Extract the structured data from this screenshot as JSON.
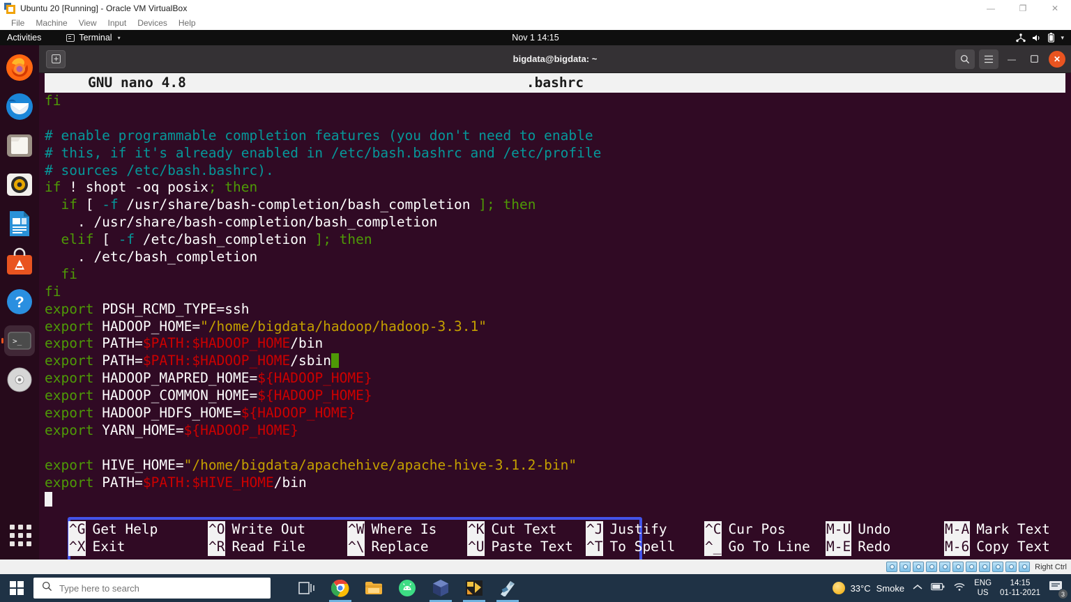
{
  "vbox": {
    "title": "Ubuntu 20 [Running] - Oracle VM VirtualBox",
    "menus": [
      "File",
      "Machine",
      "View",
      "Input",
      "Devices",
      "Help"
    ],
    "window_controls": {
      "minimize": "—",
      "maximize": "❐",
      "close": "✕"
    },
    "status_hint": "Right Ctrl"
  },
  "gnome": {
    "activities": "Activities",
    "app_name": "Terminal",
    "app_caret": "▾",
    "clock": "Nov 1  14:15",
    "tray_icons": [
      "network-icon",
      "volume-icon",
      "battery-icon",
      "chevron-down-icon"
    ]
  },
  "dock": {
    "items": [
      {
        "name": "firefox",
        "label": "Firefox"
      },
      {
        "name": "thunderbird",
        "label": "Thunderbird Mail"
      },
      {
        "name": "files",
        "label": "Files"
      },
      {
        "name": "rhythmbox",
        "label": "Rhythmbox"
      },
      {
        "name": "libreoffice-writer",
        "label": "LibreOffice Writer"
      },
      {
        "name": "ubuntu-software",
        "label": "Ubuntu Software"
      },
      {
        "name": "help",
        "label": "Help"
      },
      {
        "name": "terminal",
        "label": "Terminal"
      },
      {
        "name": "disk",
        "label": "Disk Image"
      }
    ],
    "show_apps": "Show Applications"
  },
  "terminal": {
    "title": "bigdata@bigdata: ~",
    "new_tab_label": "+",
    "search_label": "⌕",
    "menu_label": "☰",
    "minimize_label": "—",
    "maximize_label": "❐",
    "close_label": "✕"
  },
  "nano": {
    "version": "GNU nano 4.8",
    "filename": ".bashrc",
    "lines": [
      [
        {
          "t": "fi",
          "c": "c-green"
        }
      ],
      [],
      [
        {
          "t": "# enable programmable completion features (you don't need to enable",
          "c": "c-cyan"
        }
      ],
      [
        {
          "t": "# this, if it's already enabled in /etc/bash.bashrc and /etc/profile",
          "c": "c-cyan"
        }
      ],
      [
        {
          "t": "# sources /etc/bash.bashrc).",
          "c": "c-cyan"
        }
      ],
      [
        {
          "t": "if",
          "c": "c-green"
        },
        {
          "t": " ! shopt -oq posix",
          "c": "c-white"
        },
        {
          "t": "; then",
          "c": "c-green"
        }
      ],
      [
        {
          "t": "  if",
          "c": "c-green"
        },
        {
          "t": " [ ",
          "c": "c-white"
        },
        {
          "t": "-f",
          "c": "c-cyan"
        },
        {
          "t": " /usr/share/bash-completion/bash_completion ",
          "c": "c-white"
        },
        {
          "t": "]; then",
          "c": "c-green"
        }
      ],
      [
        {
          "t": "    . /usr/share/bash-completion/bash_completion",
          "c": "c-white"
        }
      ],
      [
        {
          "t": "  elif",
          "c": "c-green"
        },
        {
          "t": " [ ",
          "c": "c-white"
        },
        {
          "t": "-f",
          "c": "c-cyan"
        },
        {
          "t": " /etc/bash_completion ",
          "c": "c-white"
        },
        {
          "t": "]; then",
          "c": "c-green"
        }
      ],
      [
        {
          "t": "    . /etc/bash_completion",
          "c": "c-white"
        }
      ],
      [
        {
          "t": "  fi",
          "c": "c-green"
        }
      ],
      [
        {
          "t": "fi",
          "c": "c-green"
        }
      ],
      [
        {
          "t": "export",
          "c": "c-green"
        },
        {
          "t": " PDSH_RCMD_TYPE=ssh",
          "c": "c-white"
        }
      ],
      [
        {
          "t": "export",
          "c": "c-green"
        },
        {
          "t": " HADOOP_HOME=",
          "c": "c-white"
        },
        {
          "t": "\"/home/bigdata/hadoop/hadoop-3.3.1\"",
          "c": "c-yellow"
        }
      ],
      [
        {
          "t": "export",
          "c": "c-green"
        },
        {
          "t": " PATH=",
          "c": "c-white"
        },
        {
          "t": "$PATH:$HADOOP_HOME",
          "c": "c-red"
        },
        {
          "t": "/bin",
          "c": "c-white"
        }
      ],
      [
        {
          "t": "export",
          "c": "c-green"
        },
        {
          "t": " PATH=",
          "c": "c-white"
        },
        {
          "t": "$PATH:$HADOOP_HOME",
          "c": "c-red"
        },
        {
          "t": "/sbin",
          "c": "c-white"
        },
        {
          "t": "",
          "c": "cursor-green"
        }
      ],
      [
        {
          "t": "export",
          "c": "c-green"
        },
        {
          "t": " HADOOP_MAPRED_HOME=",
          "c": "c-white"
        },
        {
          "t": "${HADOOP_HOME}",
          "c": "c-red"
        }
      ],
      [
        {
          "t": "export",
          "c": "c-green"
        },
        {
          "t": " HADOOP_COMMON_HOME=",
          "c": "c-white"
        },
        {
          "t": "${HADOOP_HOME}",
          "c": "c-red"
        }
      ],
      [
        {
          "t": "export",
          "c": "c-green"
        },
        {
          "t": " HADOOP_HDFS_HOME=",
          "c": "c-white"
        },
        {
          "t": "${HADOOP_HOME}",
          "c": "c-red"
        }
      ],
      [
        {
          "t": "export",
          "c": "c-green"
        },
        {
          "t": " YARN_HOME=",
          "c": "c-white"
        },
        {
          "t": "${HADOOP_HOME}",
          "c": "c-red"
        }
      ],
      [],
      [
        {
          "t": "export",
          "c": "c-green"
        },
        {
          "t": " HIVE_HOME=",
          "c": "c-white"
        },
        {
          "t": "\"/home/bigdata/apachehive/apache-hive-3.1.2-bin\"",
          "c": "c-yellow"
        }
      ],
      [
        {
          "t": "export",
          "c": "c-green"
        },
        {
          "t": " PATH=",
          "c": "c-white"
        },
        {
          "t": "$PATH:$HIVE_HOME",
          "c": "c-red"
        },
        {
          "t": "/bin",
          "c": "c-white"
        }
      ],
      [
        {
          "t": "",
          "c": "cursor-white"
        }
      ]
    ],
    "shortcuts_row1": [
      {
        "key": "^G",
        "label": "Get Help"
      },
      {
        "key": "^O",
        "label": "Write Out"
      },
      {
        "key": "^W",
        "label": "Where Is"
      },
      {
        "key": "^K",
        "label": "Cut Text"
      },
      {
        "key": "^J",
        "label": "Justify"
      },
      {
        "key": "^C",
        "label": "Cur Pos"
      },
      {
        "key": "M-U",
        "label": "Undo"
      },
      {
        "key": "M-A",
        "label": "Mark Text"
      }
    ],
    "shortcuts_row2": [
      {
        "key": "^X",
        "label": "Exit"
      },
      {
        "key": "^R",
        "label": "Read File"
      },
      {
        "key": "^\\",
        "label": "Replace"
      },
      {
        "key": "^U",
        "label": "Paste Text"
      },
      {
        "key": "^T",
        "label": "To Spell"
      },
      {
        "key": "^_",
        "label": "Go To Line"
      },
      {
        "key": "M-E",
        "label": "Redo"
      },
      {
        "key": "M-6",
        "label": "Copy Text"
      }
    ]
  },
  "taskbar": {
    "search_placeholder": "Type here to search",
    "search_value": "",
    "pinned": [
      {
        "name": "task-view",
        "running": false
      },
      {
        "name": "google-chrome",
        "running": true
      },
      {
        "name": "file-explorer",
        "running": false
      },
      {
        "name": "android-studio",
        "running": false
      },
      {
        "name": "virtualbox",
        "running": true
      },
      {
        "name": "notepad-app",
        "running": true
      },
      {
        "name": "store-app",
        "running": true
      }
    ],
    "weather_temp": "33°C",
    "weather_desc": "Smoke",
    "lang_line1": "ENG",
    "lang_line2": "US",
    "clock_time": "14:15",
    "clock_date": "01-11-2021",
    "notification_count": "3"
  },
  "colors": {
    "terminal_bg": "#300a24",
    "accent_orange": "#e95420",
    "annotation_blue": "#4353e8",
    "syntax_green": "#4e9a06",
    "syntax_cyan": "#06989a",
    "syntax_yellow": "#c4a000",
    "syntax_red": "#cc0000",
    "taskbar_bg": "#1f3245"
  }
}
